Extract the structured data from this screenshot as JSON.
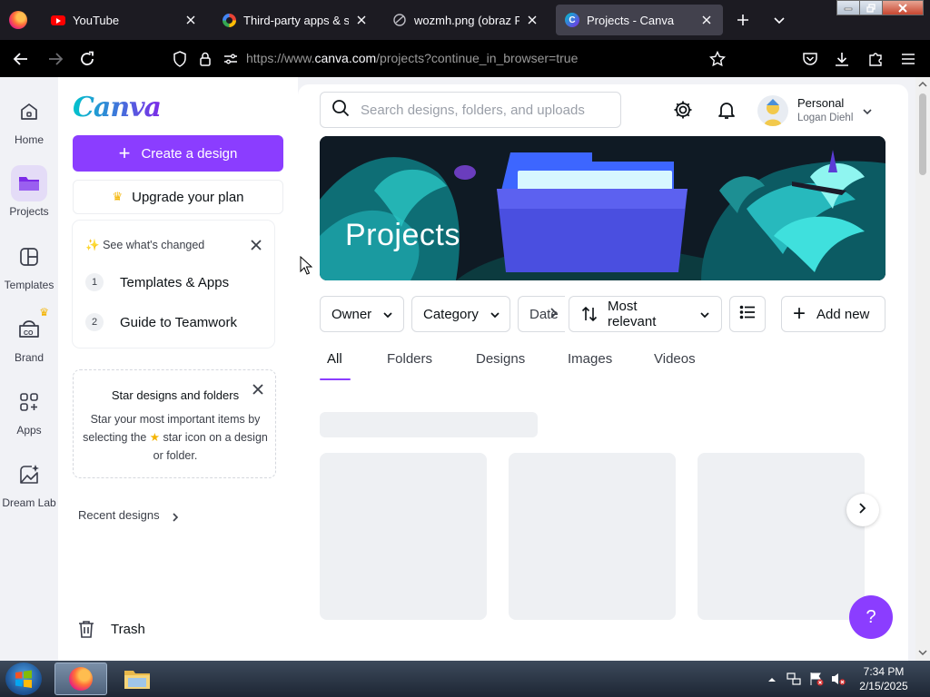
{
  "browser": {
    "tabs": [
      {
        "label": "YouTube",
        "icon": "youtube-icon"
      },
      {
        "label": "Third-party apps & serv",
        "icon": "google-icon"
      },
      {
        "label": "wozmh.png (obraz PNG,",
        "icon": "image-icon"
      },
      {
        "label": "Projects - Canva",
        "icon": "canva-icon",
        "active": true
      }
    ],
    "url_prefix": "https://www.",
    "url_domain": "canva.com",
    "url_path": "/projects?continue_in_browser=true"
  },
  "rail": {
    "items": [
      {
        "label": "Home",
        "icon": "home-icon"
      },
      {
        "label": "Projects",
        "icon": "folder-icon",
        "active": true
      },
      {
        "label": "Templates",
        "icon": "templates-icon"
      },
      {
        "label": "Brand",
        "icon": "brand-icon"
      },
      {
        "label": "Apps",
        "icon": "apps-icon"
      },
      {
        "label": "Dream Lab",
        "icon": "dream-lab-icon"
      }
    ]
  },
  "panel": {
    "logo": "Canva",
    "create_label": "Create a design",
    "upgrade_label": "Upgrade your plan",
    "changed": {
      "title": "See what's changed",
      "items": [
        {
          "num": "1",
          "label": "Templates & Apps"
        },
        {
          "num": "2",
          "label": "Guide to Teamwork"
        }
      ]
    },
    "star_card": {
      "title": "Star designs and folders",
      "body_1": "Star your most important items by selecting the",
      "body_2": "star icon on a design or folder."
    },
    "recent_label": "Recent designs",
    "trash_label": "Trash"
  },
  "header": {
    "search_placeholder": "Search designs, folders, and uploads",
    "account_type": "Personal",
    "account_name": "Logan Diehl"
  },
  "hero": {
    "title": "Projects"
  },
  "filters": {
    "owner": "Owner",
    "category": "Category",
    "date": "Date",
    "sort": "Most relevant",
    "add_new": "Add new"
  },
  "content_tabs": [
    "All",
    "Folders",
    "Designs",
    "Images",
    "Videos"
  ],
  "help_label": "?",
  "taskbar": {
    "time": "7:34 PM",
    "date": "2/15/2025"
  },
  "colors": {
    "brand_purple": "#8b3dff",
    "canva_teal": "#00c4cc"
  }
}
